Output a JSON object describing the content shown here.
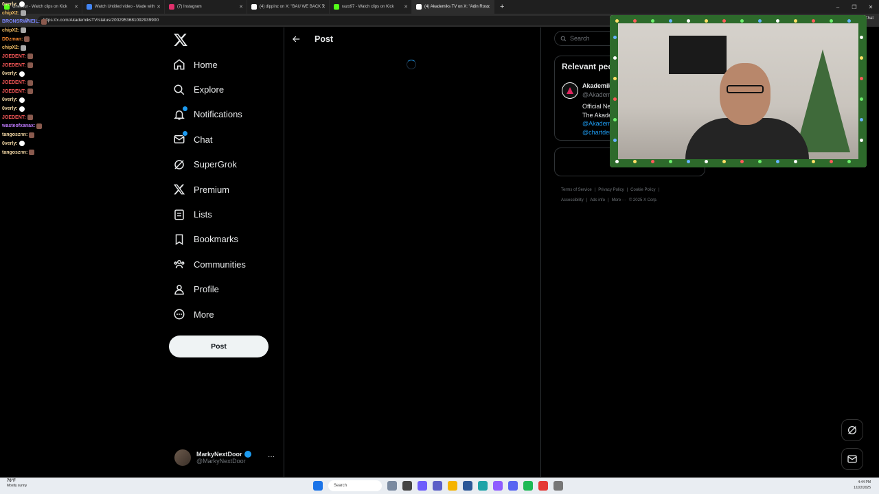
{
  "browser": {
    "tabs": [
      {
        "label": "Cheesur - Watch clips on Kick",
        "color": "#53fc18"
      },
      {
        "label": "Watch Untitled video - Made with",
        "color": "#4285f4"
      },
      {
        "label": "(7) Instagram",
        "color": "#e1306c"
      },
      {
        "label": "(4) dippinz on X: \"BAU WE BACK T",
        "color": "#ffffff"
      },
      {
        "label": "razo97 - Watch clips on Kick",
        "color": "#53fc18"
      },
      {
        "label": "(4) Akademiks TV on X: \"Adin Ross",
        "color": "#ffffff",
        "active": true
      }
    ],
    "url": "https://x.com/AkademiksTV/status/2002953681092939900",
    "chat_button": "Chat"
  },
  "kick_chat": [
    {
      "user": "0verly:",
      "color": "#f4d9a6",
      "emote": "ghost"
    },
    {
      "user": "chipX2:",
      "color": "#f7c267",
      "emote": "gray"
    },
    {
      "user": "BRONSRWNEIL:",
      "color": "#7a86ff",
      "emote": "brown"
    },
    {
      "user": "chipX2:",
      "color": "#f7c267",
      "emote": "gray"
    },
    {
      "user": "DDzman:",
      "color": "#ff8c32",
      "emote": "brown"
    },
    {
      "user": "chipX2:",
      "color": "#f7c267",
      "emote": "gray"
    },
    {
      "user": "JOEDENT:",
      "color": "#ff5a5a",
      "emote": "brown"
    },
    {
      "user": "JOEDENT:",
      "color": "#ff5a5a",
      "emote": "brown"
    },
    {
      "user": "0verly:",
      "color": "#f4d9a6",
      "emote": "ghost"
    },
    {
      "user": "JOEDENT:",
      "color": "#ff5a5a",
      "emote": "brown"
    },
    {
      "user": "JOEDENT:",
      "color": "#ff5a5a",
      "emote": "brown"
    },
    {
      "user": "0verly:",
      "color": "#f4d9a6",
      "emote": "ghost"
    },
    {
      "user": "0verly:",
      "color": "#f4d9a6",
      "emote": "ghost"
    },
    {
      "user": "JOEDENT:",
      "color": "#ff5a5a",
      "emote": "brown"
    },
    {
      "user": "wasteofxanax:",
      "color": "#c07bff",
      "emote": "brown"
    },
    {
      "user": "tangosznn:",
      "color": "#f4d9a6",
      "emote": "brown"
    },
    {
      "user": "0verly:",
      "color": "#f4d9a6",
      "emote": "ghost"
    },
    {
      "user": "tangosznn:",
      "color": "#f4d9a6",
      "emote": "brown"
    }
  ],
  "nav": [
    {
      "label": "Home",
      "icon": "home-icon"
    },
    {
      "label": "Explore",
      "icon": "search-icon"
    },
    {
      "label": "Notifications",
      "icon": "bell-icon",
      "badge": true
    },
    {
      "label": "Chat",
      "icon": "mail-icon",
      "badge": true
    },
    {
      "label": "SuperGrok",
      "icon": "grok-icon"
    },
    {
      "label": "Premium",
      "icon": "x-icon"
    },
    {
      "label": "Lists",
      "icon": "list-icon"
    },
    {
      "label": "Bookmarks",
      "icon": "bookmark-icon"
    },
    {
      "label": "Communities",
      "icon": "communities-icon"
    },
    {
      "label": "Profile",
      "icon": "person-icon"
    },
    {
      "label": "More",
      "icon": "more-circle-icon"
    }
  ],
  "post_button": "Post",
  "account": {
    "name": "MarkyNextDoor",
    "handle": "@MarkyNextDoor",
    "more": "···"
  },
  "main": {
    "title": "Post"
  },
  "right": {
    "search_placeholder": "Search",
    "relevant_title": "Relevant peo",
    "person": {
      "name": "Akademiks",
      "handle": "@Akademiks",
      "bio1": "Official Ne",
      "bio2": "The Akade",
      "link1": "@Akademik",
      "link2": "@chartdem"
    }
  },
  "footer": [
    "Terms of Service",
    "|",
    "Privacy Policy",
    "|",
    "Cookie Policy",
    "|",
    "Accessibility",
    "|",
    "Ads info",
    "|",
    "More ···",
    "© 2025 X Corp."
  ],
  "taskbar": {
    "weather_temp": "76°F",
    "weather_desc": "Mostly sunny",
    "search": "Search",
    "time": "4:44 PM",
    "date": "12/22/2025"
  },
  "colors": {
    "accent": "#1d9bf0",
    "background": "#000000"
  }
}
